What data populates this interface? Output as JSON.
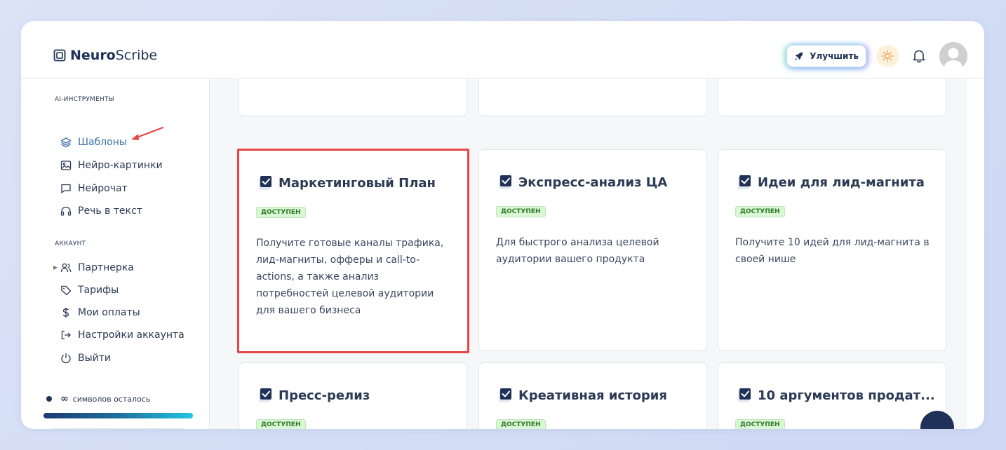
{
  "logo": {
    "bold": "Neuro",
    "regular": "Scribe"
  },
  "header": {
    "upgrade_label": "Улучшить"
  },
  "sidebar": {
    "tools_title": "AI-ИНСТРУМЕНТЫ",
    "tools": [
      {
        "label": "Шаблоны",
        "icon": "layers-icon",
        "active": true
      },
      {
        "label": "Нейро-картинки",
        "icon": "image-icon"
      },
      {
        "label": "Нейрочат",
        "icon": "chat-icon"
      },
      {
        "label": "Речь в текст",
        "icon": "headphones-icon"
      }
    ],
    "account_title": "АККАУНТ",
    "account": [
      {
        "label": "Партнерка",
        "icon": "users-icon"
      },
      {
        "label": "Тарифы",
        "icon": "tag-icon"
      },
      {
        "label": "Мои оплаты",
        "icon": "dollar-icon"
      },
      {
        "label": "Настройки аккаунта",
        "icon": "logout-arrow-icon"
      },
      {
        "label": "Выйти",
        "icon": "power-icon"
      }
    ],
    "usage": {
      "symbol": "∞",
      "label": "символов осталось"
    }
  },
  "cards": [
    {
      "title": "Маркетинговый План",
      "badge": "ДОСТУПЕН",
      "description": "Получите готовые каналы трафика, лид-магниты, офферы и call-to-actions, а также анализ потребностей целевой аудитории для вашего бизнеса"
    },
    {
      "title": "Экспресс-анализ ЦА",
      "badge": "ДОСТУПЕН",
      "description": "Для быстрого анализа целевой аудитории вашего продукта"
    },
    {
      "title": "Идеи для лид-магнита",
      "badge": "ДОСТУПЕН",
      "description": "Получите 10 идей для лид-магнита в своей нише"
    },
    {
      "title": "Пресс-релиз",
      "badge": "ДОСТУПЕН",
      "description": ""
    },
    {
      "title": "Креативная история",
      "badge": "ДОСТУПЕН",
      "description": ""
    },
    {
      "title": "10 аргументов продат...",
      "badge": "ДОСТУПЕН",
      "description": ""
    }
  ],
  "colors": {
    "accent": "#1f3158",
    "active": "#3a6ea8",
    "highlight": "#e84545",
    "badge_bg": "#d9f7d4"
  }
}
